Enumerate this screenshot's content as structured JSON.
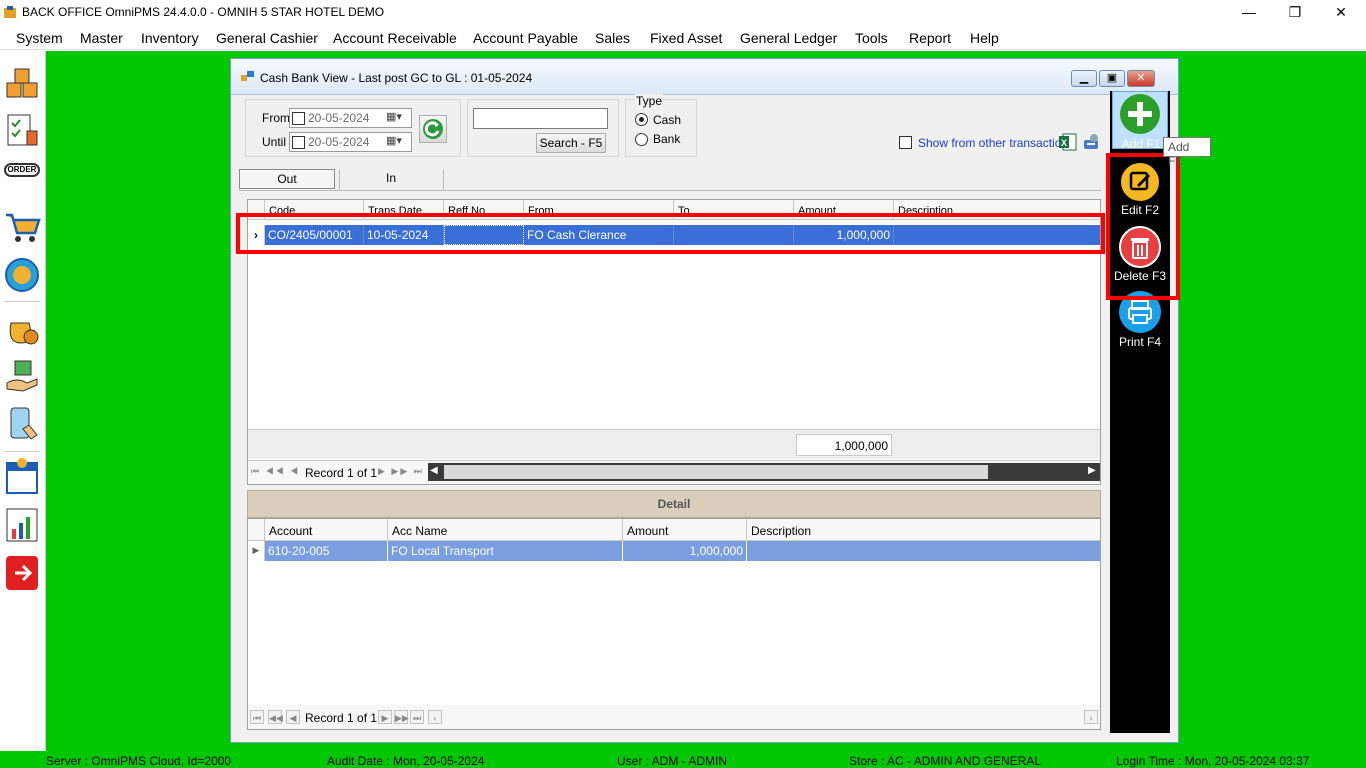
{
  "window": {
    "title": "BACK OFFICE OmniPMS 24.4.0.0 - OMNIH 5 STAR HOTEL DEMO",
    "minimize": "—",
    "restore": "❐",
    "close": "✕"
  },
  "menu": [
    "System",
    "Master",
    "Inventory",
    "General Cashier",
    "Account Receivable",
    "Account Payable",
    "Sales",
    "Fixed Asset",
    "General Ledger",
    "Tools",
    "Report",
    "Help"
  ],
  "toolbar_icons": [
    "boxes-icon",
    "clipboard-check-icon",
    "order-icon",
    "shopping-cart-icon",
    "refresh-circle-icon",
    "money-bags-icon",
    "hand-money-icon",
    "mobile-touch-icon",
    "calendar-icon",
    "chart-icon",
    "exit-icon"
  ],
  "toolbar_order_text": "ORDER",
  "dialog": {
    "title": "Cash Bank View - Last post GC to GL : 01-05-2024",
    "filter": {
      "from_label": "From",
      "until_label": "Until",
      "from_date": "20-05-2024",
      "until_date": "20-05-2024",
      "search_value": "",
      "search_button": "Search - F5",
      "type_label": "Type",
      "type_options": [
        "Cash",
        "Bank"
      ],
      "type_selected": "Cash",
      "show_other": "Show from other transaction"
    },
    "tabs": [
      "Out",
      "In"
    ],
    "active_tab": "Out",
    "main_grid": {
      "columns": [
        "Code",
        "Trans Date",
        "Reff No",
        "From",
        "To",
        "Amount",
        "Description"
      ],
      "rows": [
        {
          "code": "CO/2405/00001",
          "trans_date": "10-05-2024",
          "reff_no": "",
          "from": "FO Cash Clerance",
          "to": "",
          "amount": "1,000,000",
          "description": ""
        }
      ],
      "total": "1,000,000",
      "record_text": "Record 1 of 1"
    },
    "detail": {
      "title": "Detail",
      "columns": [
        "Account",
        "Acc Name",
        "Amount",
        "Description"
      ],
      "rows": [
        {
          "account": "610-20-005",
          "acc_name": "FO Local Transport",
          "amount": "1,000,000",
          "description": ""
        }
      ],
      "record_text": "Record 1 of 1"
    }
  },
  "side_actions": {
    "add": "Add F1",
    "add_tooltip": "Add F1",
    "edit": "Edit F2",
    "delete": "Delete F3",
    "print": "Print F4"
  },
  "status": {
    "server": "Server : OmniPMS Cloud, Id=2000",
    "audit_date": "Audit Date : Mon, 20-05-2024",
    "user": "User : ADM - ADMIN",
    "store": "Store : AC - ADMIN AND GENERAL",
    "login_time": "Login Time : Mon, 20-05-2024 03:37"
  },
  "colors": {
    "workspace": "#00c800",
    "selected_row": "#3a6fd8",
    "detail_row": "#7b9ee0",
    "highlight": "#ff0000"
  }
}
